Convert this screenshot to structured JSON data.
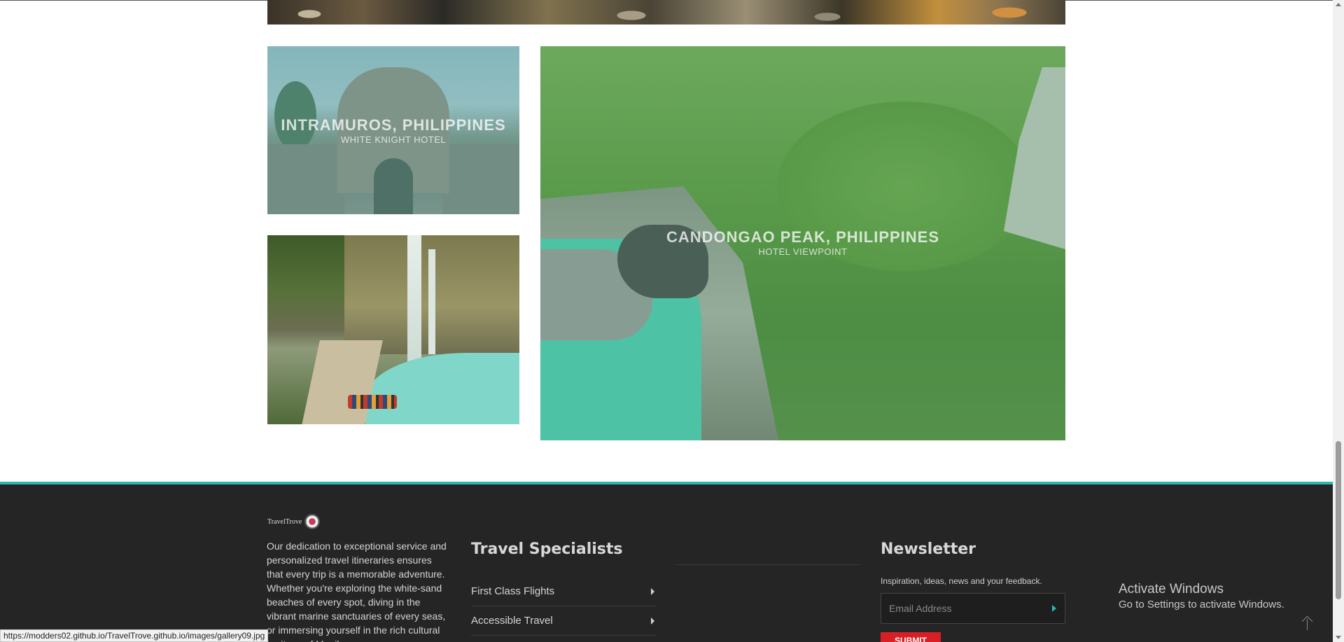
{
  "gallery": {
    "tiles": [
      {
        "title": "INTRAMUROS, PHILIPPINES",
        "subtitle": "WHITE KNIGHT HOTEL"
      },
      {
        "title": "",
        "subtitle": ""
      },
      {
        "title": "CANDONGAO PEAK, PHILIPPINES",
        "subtitle": "HOTEL VIEWPOINT"
      }
    ]
  },
  "footer": {
    "logo_text": "TravelTrove",
    "about": "Our dedication to exceptional service and personalized travel itineraries ensures that every trip is a memorable adventure. Whether you're exploring the white-sand beaches of every spot, diving in the vibrant marine sanctuaries of every seas, or immersing yourself in the rich cultural heritage of Manila, we",
    "specialists": {
      "title": "Travel Specialists",
      "items": [
        "First Class Flights",
        "Accessible Travel"
      ]
    },
    "newsletter": {
      "title": "Newsletter",
      "subtitle": "Inspiration, ideas, news and your feedback.",
      "email_placeholder": "Email Address",
      "submit_label": "SUBMIT"
    }
  },
  "windows_watermark": {
    "line1": "Activate Windows",
    "line2": "Go to Settings to activate Windows."
  },
  "status_bar": {
    "url": "https://modders02.github.io/TravelTrove.github.io/images/gallery09.jpg"
  },
  "colors": {
    "accent": "#2bb6b0",
    "submit": "#d81f26",
    "footer_bg": "#252525"
  }
}
